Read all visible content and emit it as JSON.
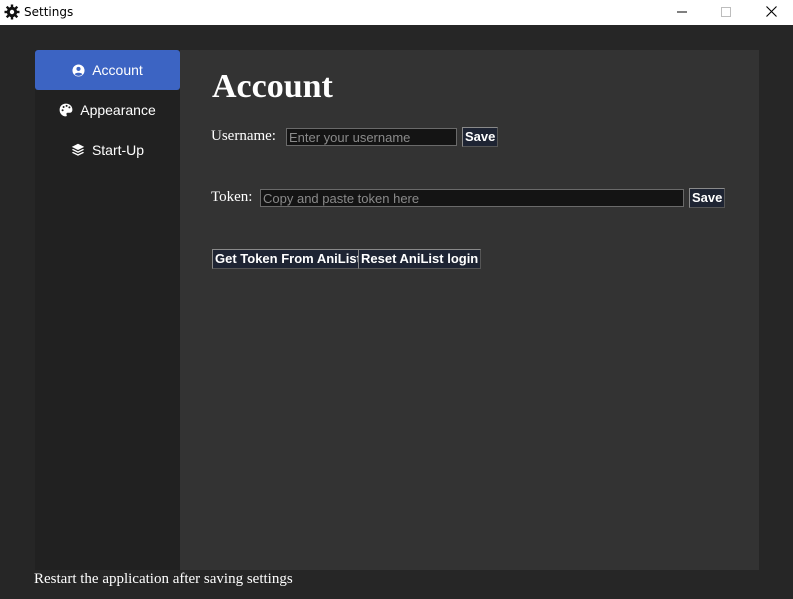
{
  "window": {
    "title": "Settings"
  },
  "sidebar": {
    "items": [
      {
        "label": "Account",
        "icon": "user-circle-icon",
        "active": true
      },
      {
        "label": "Appearance",
        "icon": "palette-icon",
        "active": false
      },
      {
        "label": "Start-Up",
        "icon": "layers-icon",
        "active": false
      }
    ]
  },
  "account": {
    "title": "Account",
    "username_label": "Username:",
    "username_placeholder": "Enter your username",
    "username_value": "",
    "username_save": "Save",
    "token_label": "Token:",
    "token_placeholder": "Copy and paste token here",
    "token_value": "",
    "token_save": "Save",
    "get_token_button": "Get Token From AniList",
    "reset_button": "Reset AniList login"
  },
  "footer": {
    "note": "Restart the application after saving settings"
  },
  "colors": {
    "accent": "#3c64c3",
    "sidebar_bg": "#212121",
    "panel_bg": "#333333",
    "window_bg": "#262626"
  }
}
